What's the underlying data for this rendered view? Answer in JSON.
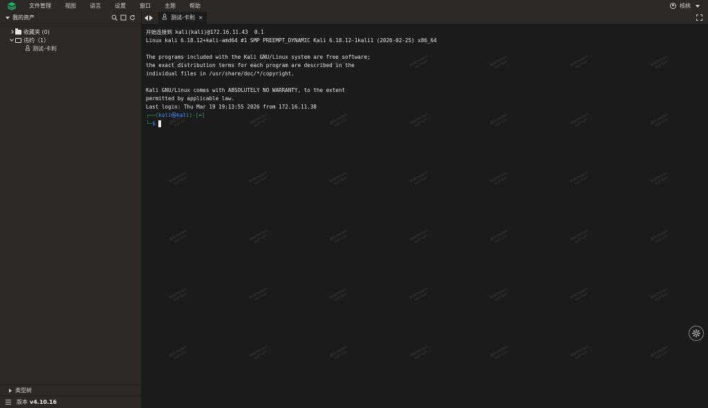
{
  "menubar": {
    "items": [
      "文件管理",
      "视图",
      "语言",
      "设置",
      "窗口",
      "主题",
      "帮助"
    ],
    "user_name": "核桃"
  },
  "sidebar": {
    "title": "我的资产",
    "tree": [
      {
        "label": "收藏夹 (0)",
        "level": 0,
        "expanded": false
      },
      {
        "label": "违约（1）",
        "level": 0,
        "expanded": true
      },
      {
        "label": "测试-卡利",
        "level": 1,
        "expanded": false
      }
    ],
    "type_tree_label": "类型树",
    "version_label": "版本",
    "version_value": "v4.10.16"
  },
  "tabs": [
    {
      "label": "测试-卡利",
      "close": "×"
    }
  ],
  "terminal": {
    "lines": [
      "开始连接到 kali(kali)@172.16.11.43  0.1",
      "Linux kali 6.18.12+kali-amd64 #1 SMP PREEMPT_DYNAMIC Kali 6.18.12-1kali1 (2026-02-25) x86_64",
      "",
      "The programs included with the Kali GNU/Linux system are free software;",
      "the exact distribution terms for each program are described in the",
      "individual files in /usr/share/doc/*/copyright.",
      "",
      "Kali GNU/Linux comes with ABSOLUTELY NO WARRANTY, to the extent",
      "permitted by applicable law.",
      "Last login: Thu Mar 19 19:13:55 2026 from 172.16.11.38"
    ],
    "prompt": {
      "frame_open": "┌──(",
      "user": "kali㉿kali",
      "frame_mid": ")-[",
      "dir": "~",
      "frame_close": "]",
      "line2_frame": "└─",
      "symbol": "$"
    },
    "watermark": {
      "line1": "核桃(hetao)",
      "line2": "test-kali"
    }
  },
  "colors": {
    "accent": "#1faa48",
    "prompt_user": "#3c8cff",
    "background": "#1b1b1b",
    "panel": "#2c2826"
  }
}
